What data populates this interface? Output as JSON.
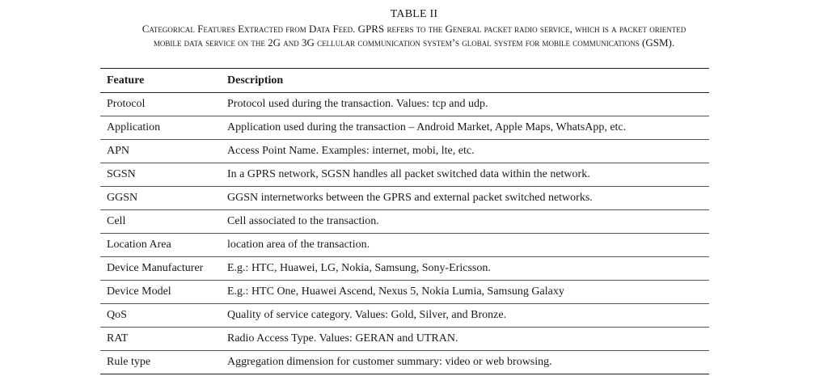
{
  "caption": {
    "number": "TABLE II",
    "line1": "Categorical Features Extracted from Data Feed. GPRS refers to the General packet radio service, which is a packet oriented",
    "line2": "mobile data service on the 2G and 3G cellular communication system’s global system for mobile communications (GSM)."
  },
  "table": {
    "headers": {
      "feature": "Feature",
      "description": "Description"
    },
    "rows": [
      {
        "feature": "Protocol",
        "description": "Protocol used during the transaction. Values: tcp and udp."
      },
      {
        "feature": "Application",
        "description": "Application used during the transaction – Android Market, Apple Maps, WhatsApp, etc."
      },
      {
        "feature": "APN",
        "description": "Access Point Name. Examples: internet, mobi, lte, etc."
      },
      {
        "feature": "SGSN",
        "description": "In a GPRS network, SGSN handles all packet switched data within the network."
      },
      {
        "feature": "GGSN",
        "description": "GGSN internetworks between the GPRS and external packet switched networks."
      },
      {
        "feature": "Cell",
        "description": "Cell associated to the transaction."
      },
      {
        "feature": "Location Area",
        "description": "location area of the transaction."
      },
      {
        "feature": "Device Manufacturer",
        "description": "E.g.: HTC, Huawei, LG, Nokia, Samsung, Sony-Ericsson."
      },
      {
        "feature": "Device Model",
        "description": "E.g.: HTC One, Huawei Ascend, Nexus 5, Nokia Lumia, Samsung Galaxy"
      },
      {
        "feature": "QoS",
        "description": "Quality of service category. Values: Gold, Silver, and Bronze."
      },
      {
        "feature": "RAT",
        "description": "Radio Access Type. Values: GERAN and UTRAN."
      },
      {
        "feature": "Rule type",
        "description": "Aggregation dimension for customer summary: video or web browsing."
      }
    ]
  }
}
